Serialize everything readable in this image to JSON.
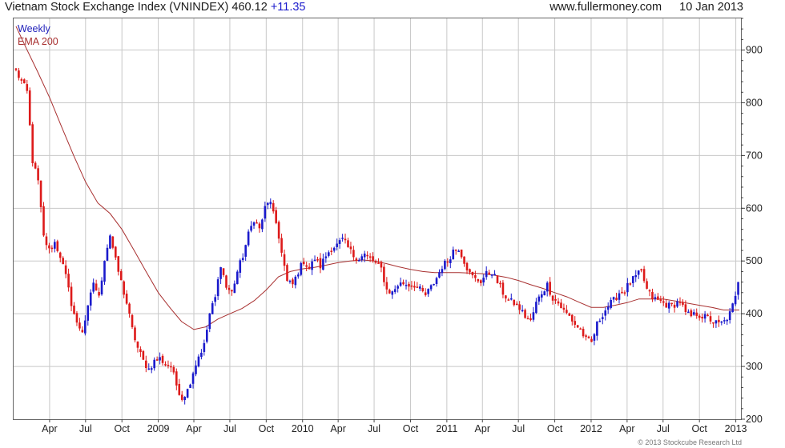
{
  "header": {
    "title": "Vietnam Stock Exchange Index (VNINDEX)",
    "price": "460.12",
    "change": "+11.35",
    "site": "www.fullermoney.com",
    "date": "10 Jan 2013"
  },
  "legend": {
    "weekly": "Weekly",
    "ema": "EMA 200"
  },
  "footer": {
    "copyright": "© 2013 Stockcube Research Ltd"
  },
  "colors": {
    "up": "#1a1acc",
    "down": "#dd1a1a",
    "ema": "#a83030",
    "grid": "#c8c8c8"
  },
  "chart_data": {
    "type": "candlestick",
    "title": "Vietnam Stock Exchange Index (VNINDEX)",
    "frequency": "Weekly",
    "ylim": [
      200,
      960
    ],
    "yticks": [
      200,
      300,
      400,
      500,
      600,
      700,
      800,
      900
    ],
    "x_date_range": [
      "2008-01-01",
      "2013-01-14"
    ],
    "xticks": [
      {
        "label": "Apr",
        "date": "2008-04-01"
      },
      {
        "label": "Jul",
        "date": "2008-07-01"
      },
      {
        "label": "Oct",
        "date": "2008-10-01"
      },
      {
        "label": "2009",
        "date": "2009-01-01"
      },
      {
        "label": "Apr",
        "date": "2009-04-01"
      },
      {
        "label": "Jul",
        "date": "2009-07-01"
      },
      {
        "label": "Oct",
        "date": "2009-10-01"
      },
      {
        "label": "2010",
        "date": "2010-01-01"
      },
      {
        "label": "Apr",
        "date": "2010-04-01"
      },
      {
        "label": "Jul",
        "date": "2010-07-01"
      },
      {
        "label": "Oct",
        "date": "2010-10-01"
      },
      {
        "label": "2011",
        "date": "2011-01-01"
      },
      {
        "label": "Apr",
        "date": "2011-04-01"
      },
      {
        "label": "Jul",
        "date": "2011-07-01"
      },
      {
        "label": "Oct",
        "date": "2011-10-01"
      },
      {
        "label": "2012",
        "date": "2012-01-01"
      },
      {
        "label": "Apr",
        "date": "2012-04-01"
      },
      {
        "label": "Jul",
        "date": "2012-07-01"
      },
      {
        "label": "Oct",
        "date": "2012-10-01"
      },
      {
        "label": "2013",
        "date": "2013-01-01"
      }
    ],
    "close_points": [
      [
        "2008-01-07",
        860
      ],
      [
        "2008-01-21",
        840
      ],
      [
        "2008-02-04",
        820
      ],
      [
        "2008-02-18",
        690
      ],
      [
        "2008-03-03",
        650
      ],
      [
        "2008-03-17",
        545
      ],
      [
        "2008-03-31",
        520
      ],
      [
        "2008-04-14",
        535
      ],
      [
        "2008-04-28",
        510
      ],
      [
        "2008-05-12",
        470
      ],
      [
        "2008-05-26",
        420
      ],
      [
        "2008-06-09",
        380
      ],
      [
        "2008-06-23",
        368
      ],
      [
        "2008-07-07",
        410
      ],
      [
        "2008-07-21",
        460
      ],
      [
        "2008-08-04",
        430
      ],
      [
        "2008-08-18",
        505
      ],
      [
        "2008-09-01",
        550
      ],
      [
        "2008-09-15",
        500
      ],
      [
        "2008-09-29",
        460
      ],
      [
        "2008-10-13",
        420
      ],
      [
        "2008-10-27",
        370
      ],
      [
        "2008-11-10",
        335
      ],
      [
        "2008-11-24",
        310
      ],
      [
        "2008-12-08",
        295
      ],
      [
        "2008-12-22",
        310
      ],
      [
        "2009-01-05",
        315
      ],
      [
        "2009-01-19",
        305
      ],
      [
        "2009-02-02",
        300
      ],
      [
        "2009-02-16",
        265
      ],
      [
        "2009-03-02",
        240
      ],
      [
        "2009-03-16",
        255
      ],
      [
        "2009-03-30",
        290
      ],
      [
        "2009-04-13",
        320
      ],
      [
        "2009-04-27",
        340
      ],
      [
        "2009-05-11",
        400
      ],
      [
        "2009-05-25",
        430
      ],
      [
        "2009-06-08",
        495
      ],
      [
        "2009-06-22",
        450
      ],
      [
        "2009-07-06",
        440
      ],
      [
        "2009-07-20",
        480
      ],
      [
        "2009-08-03",
        510
      ],
      [
        "2009-08-17",
        550
      ],
      [
        "2009-08-31",
        580
      ],
      [
        "2009-09-14",
        560
      ],
      [
        "2009-09-28",
        600
      ],
      [
        "2009-10-12",
        615
      ],
      [
        "2009-10-26",
        565
      ],
      [
        "2009-11-09",
        520
      ],
      [
        "2009-11-23",
        460
      ],
      [
        "2009-12-07",
        455
      ],
      [
        "2009-12-21",
        480
      ],
      [
        "2010-01-04",
        500
      ],
      [
        "2010-01-18",
        485
      ],
      [
        "2010-02-01",
        505
      ],
      [
        "2010-02-15",
        490
      ],
      [
        "2010-03-01",
        510
      ],
      [
        "2010-03-15",
        525
      ],
      [
        "2010-03-29",
        530
      ],
      [
        "2010-04-12",
        540
      ],
      [
        "2010-04-26",
        525
      ],
      [
        "2010-05-10",
        510
      ],
      [
        "2010-05-24",
        505
      ],
      [
        "2010-06-07",
        512
      ],
      [
        "2010-06-21",
        505
      ],
      [
        "2010-07-05",
        495
      ],
      [
        "2010-07-19",
        485
      ],
      [
        "2010-08-02",
        445
      ],
      [
        "2010-08-16",
        440
      ],
      [
        "2010-08-30",
        455
      ],
      [
        "2010-09-13",
        458
      ],
      [
        "2010-09-27",
        455
      ],
      [
        "2010-10-11",
        455
      ],
      [
        "2010-10-25",
        445
      ],
      [
        "2010-11-08",
        435
      ],
      [
        "2010-11-22",
        450
      ],
      [
        "2010-12-06",
        468
      ],
      [
        "2010-12-20",
        490
      ],
      [
        "2011-01-03",
        500
      ],
      [
        "2011-01-17",
        520
      ],
      [
        "2011-01-31",
        525
      ],
      [
        "2011-02-14",
        500
      ],
      [
        "2011-02-28",
        475
      ],
      [
        "2011-03-14",
        465
      ],
      [
        "2011-03-28",
        462
      ],
      [
        "2011-04-11",
        475
      ],
      [
        "2011-04-25",
        480
      ],
      [
        "2011-05-09",
        460
      ],
      [
        "2011-05-23",
        440
      ],
      [
        "2011-06-06",
        425
      ],
      [
        "2011-06-20",
        420
      ],
      [
        "2011-07-04",
        410
      ],
      [
        "2011-07-18",
        395
      ],
      [
        "2011-08-01",
        385
      ],
      [
        "2011-08-15",
        420
      ],
      [
        "2011-08-29",
        440
      ],
      [
        "2011-09-12",
        455
      ],
      [
        "2011-09-26",
        430
      ],
      [
        "2011-10-10",
        420
      ],
      [
        "2011-10-24",
        405
      ],
      [
        "2011-11-07",
        395
      ],
      [
        "2011-11-21",
        380
      ],
      [
        "2011-12-05",
        370
      ],
      [
        "2011-12-19",
        350
      ],
      [
        "2012-01-02",
        345
      ],
      [
        "2012-01-16",
        380
      ],
      [
        "2012-01-30",
        400
      ],
      [
        "2012-02-13",
        415
      ],
      [
        "2012-02-27",
        425
      ],
      [
        "2012-03-12",
        440
      ],
      [
        "2012-03-26",
        445
      ],
      [
        "2012-04-09",
        460
      ],
      [
        "2012-04-23",
        470
      ],
      [
        "2012-05-07",
        480
      ],
      [
        "2012-05-21",
        445
      ],
      [
        "2012-06-04",
        430
      ],
      [
        "2012-06-18",
        425
      ],
      [
        "2012-07-02",
        420
      ],
      [
        "2012-07-16",
        415
      ],
      [
        "2012-07-30",
        418
      ],
      [
        "2012-08-13",
        425
      ],
      [
        "2012-08-27",
        400
      ],
      [
        "2012-09-10",
        395
      ],
      [
        "2012-09-24",
        400
      ],
      [
        "2012-10-08",
        395
      ],
      [
        "2012-10-22",
        392
      ],
      [
        "2012-11-05",
        385
      ],
      [
        "2012-11-19",
        380
      ],
      [
        "2012-12-03",
        385
      ],
      [
        "2012-12-17",
        400
      ],
      [
        "2012-12-31",
        430
      ],
      [
        "2013-01-10",
        460.12
      ]
    ],
    "series": [
      {
        "name": "EMA 200",
        "points": [
          [
            "2008-01-07",
            945
          ],
          [
            "2008-02-01",
            905
          ],
          [
            "2008-03-01",
            860
          ],
          [
            "2008-04-01",
            810
          ],
          [
            "2008-05-01",
            755
          ],
          [
            "2008-06-01",
            700
          ],
          [
            "2008-07-01",
            650
          ],
          [
            "2008-08-01",
            610
          ],
          [
            "2008-09-01",
            590
          ],
          [
            "2008-10-01",
            560
          ],
          [
            "2008-11-01",
            520
          ],
          [
            "2008-12-01",
            480
          ],
          [
            "2009-01-01",
            440
          ],
          [
            "2009-02-01",
            410
          ],
          [
            "2009-03-01",
            385
          ],
          [
            "2009-04-01",
            370
          ],
          [
            "2009-05-01",
            375
          ],
          [
            "2009-06-01",
            390
          ],
          [
            "2009-07-01",
            400
          ],
          [
            "2009-08-01",
            410
          ],
          [
            "2009-09-01",
            425
          ],
          [
            "2009-10-01",
            445
          ],
          [
            "2009-11-01",
            470
          ],
          [
            "2009-12-01",
            480
          ],
          [
            "2010-01-01",
            485
          ],
          [
            "2010-02-01",
            488
          ],
          [
            "2010-03-01",
            492
          ],
          [
            "2010-04-01",
            497
          ],
          [
            "2010-05-01",
            500
          ],
          [
            "2010-06-01",
            502
          ],
          [
            "2010-07-01",
            500
          ],
          [
            "2010-08-01",
            495
          ],
          [
            "2010-09-01",
            489
          ],
          [
            "2010-10-01",
            484
          ],
          [
            "2010-11-01",
            480
          ],
          [
            "2010-12-01",
            478
          ],
          [
            "2011-01-01",
            478
          ],
          [
            "2011-02-01",
            478
          ],
          [
            "2011-03-01",
            477
          ],
          [
            "2011-04-01",
            476
          ],
          [
            "2011-05-01",
            473
          ],
          [
            "2011-06-01",
            469
          ],
          [
            "2011-07-01",
            463
          ],
          [
            "2011-08-01",
            455
          ],
          [
            "2011-09-01",
            448
          ],
          [
            "2011-10-01",
            440
          ],
          [
            "2011-11-01",
            432
          ],
          [
            "2011-12-01",
            422
          ],
          [
            "2012-01-01",
            412
          ],
          [
            "2012-02-01",
            412
          ],
          [
            "2012-03-01",
            416
          ],
          [
            "2012-04-01",
            421
          ],
          [
            "2012-05-01",
            428
          ],
          [
            "2012-06-01",
            428
          ],
          [
            "2012-07-01",
            428
          ],
          [
            "2012-08-01",
            424
          ],
          [
            "2012-09-01",
            420
          ],
          [
            "2012-10-01",
            416
          ],
          [
            "2012-11-01",
            412
          ],
          [
            "2012-12-01",
            407
          ],
          [
            "2013-01-10",
            407
          ]
        ]
      }
    ],
    "grid": true
  }
}
